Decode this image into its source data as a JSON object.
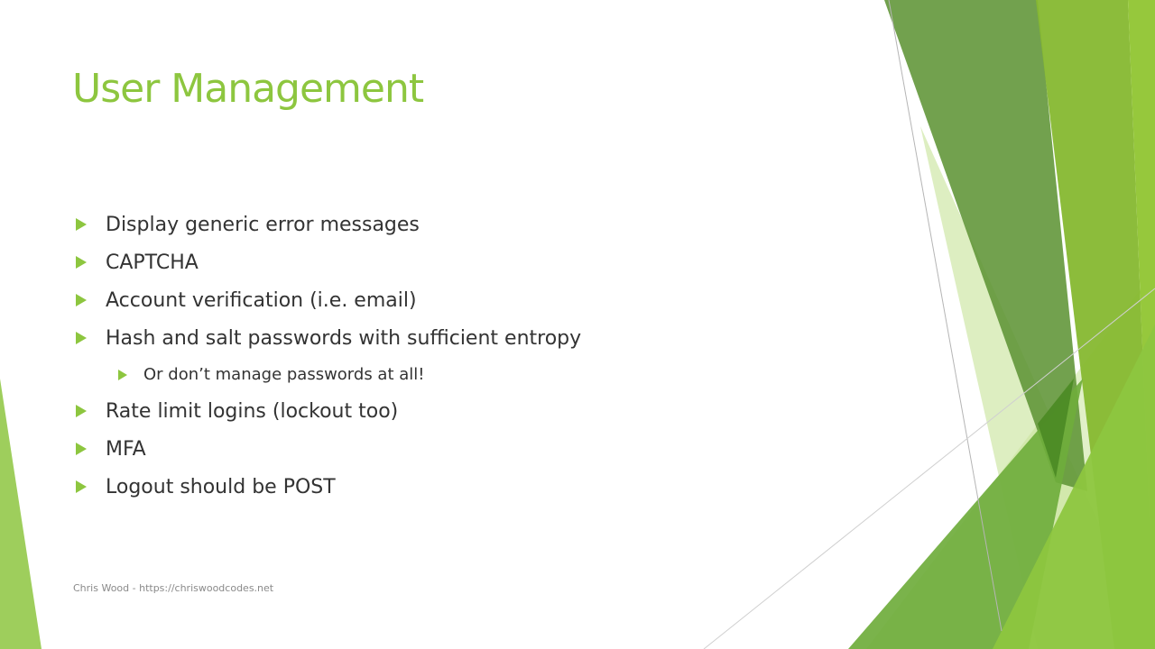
{
  "slide": {
    "title": "User Management",
    "bullets": [
      {
        "text": "Display generic error messages",
        "level": 1
      },
      {
        "text": "CAPTCHA",
        "level": 1
      },
      {
        "text": "Account verification (i.e. email)",
        "level": 1
      },
      {
        "text": "Hash and salt passwords with sufficient entropy",
        "level": 1
      },
      {
        "text": "Or don’t manage passwords at all!",
        "level": 2
      },
      {
        "text": "Rate limit logins (lockout too)",
        "level": 1
      },
      {
        "text": "MFA",
        "level": 1
      },
      {
        "text": "Logout should be POST",
        "level": 1
      }
    ],
    "footer": "Chris Wood - https://chriswoodcodes.net"
  },
  "theme": {
    "accent": "#8dc63f",
    "title_color": "#8dc63f",
    "body_text": "#333333",
    "footer_text": "#8a8a8a",
    "bullet_marker": "triangle-right-icon"
  }
}
